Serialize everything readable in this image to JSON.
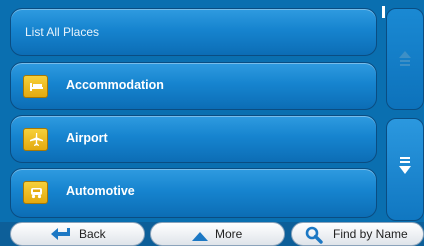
{
  "list": {
    "header": "List All Places",
    "items": [
      {
        "label": "Accommodation",
        "icon": "bed-icon"
      },
      {
        "label": "Airport",
        "icon": "airplane-icon"
      },
      {
        "label": "Automotive",
        "icon": "car-icon"
      }
    ]
  },
  "scrollbar": {
    "up_icon": "scroll-up-icon",
    "down_icon": "scroll-down-icon"
  },
  "bottom_bar": {
    "back_label": "Back",
    "more_label": "More",
    "find_label": "Find by Name"
  },
  "colors": {
    "accent": "#1684cf",
    "category_icon": "#f2c12e"
  }
}
